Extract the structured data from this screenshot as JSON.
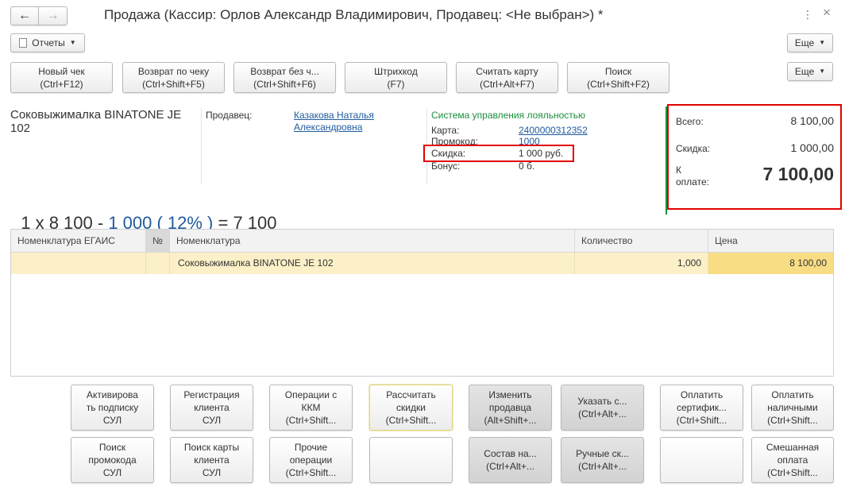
{
  "window": {
    "title": "Продажа (Кассир: Орлов Александр Владимирович, Продавец: <Не выбран>) *",
    "more_icon": "⋮",
    "close_icon": "×"
  },
  "toolbar": {
    "reports_label": "Отчеты",
    "more_label": "Еще"
  },
  "actions": [
    {
      "line1": "Новый чек",
      "line2": "(Ctrl+F12)"
    },
    {
      "line1": "Возврат по чеку",
      "line2": "(Ctrl+Shift+F5)"
    },
    {
      "line1": "Возврат без ч...",
      "line2": "(Ctrl+Shift+F6)"
    },
    {
      "line1": "Штрихкод",
      "line2": "(F7)"
    },
    {
      "line1": "Считать карту",
      "line2": "(Ctrl+Alt+F7)"
    },
    {
      "line1": "Поиск",
      "line2": "(Ctrl+Shift+F2)"
    }
  ],
  "actions_more_label": "Еще",
  "product": {
    "name": "Соковыжималка  BINATONE JE 102"
  },
  "seller": {
    "label": "Продавец:",
    "name": "Казакова Наталья Александровна"
  },
  "loyalty": {
    "title": "Система управления лояльностью",
    "card_label": "Карта:",
    "card_value": "2400000312352",
    "promo_label": "Промокод:",
    "promo_value": "1000",
    "discount_label": "Скидка:",
    "discount_value": "1 000 руб.",
    "bonus_label": "Бонус:",
    "bonus_value": "0 б."
  },
  "totals": {
    "total_label": "Всего:",
    "total_value": "8 100,00",
    "discount_label": "Скидка:",
    "discount_value": "1 000,00",
    "pay_label_1": "К",
    "pay_label_2": "оплате:",
    "pay_value": "7 100,00"
  },
  "formula": {
    "prefix": "1 х 8 100 - ",
    "discount_link": "1 000 ( 12% )",
    "suffix": " = 7 100"
  },
  "table": {
    "columns": [
      "Номенклатура ЕГАИС",
      "№",
      "Номенклатура",
      "Количество",
      "Цена"
    ],
    "rows": [
      {
        "egais": "",
        "num": "",
        "name": "Соковыжималка  BINATONE JE 102",
        "qty": "1,000",
        "price": "8 100,00"
      }
    ]
  },
  "bottom_buttons_row1": [
    {
      "lines": [
        "Активирова",
        "ть подписку",
        "СУЛ"
      ]
    },
    {
      "lines": [
        "Регистрация",
        "клиента",
        "СУЛ"
      ]
    },
    {
      "lines": [
        "Операции с",
        "ККМ",
        "(Ctrl+Shift..."
      ]
    },
    {
      "lines": [
        "Рассчитать",
        "скидки",
        "(Ctrl+Shift..."
      ]
    },
    {
      "lines": [
        "Изменить",
        "продавца",
        "(Alt+Shift+..."
      ]
    },
    {
      "lines": [
        "Указать с...",
        "(Ctrl+Alt+..."
      ]
    },
    {
      "lines": [
        "Оплатить",
        "сертифик...",
        "(Ctrl+Shift..."
      ]
    },
    {
      "lines": [
        "Оплатить",
        "наличными",
        "(Ctrl+Shift..."
      ]
    }
  ],
  "bottom_buttons_row2": [
    {
      "lines": [
        "Поиск",
        "промокода",
        "СУЛ"
      ]
    },
    {
      "lines": [
        "Поиск карты",
        "клиента",
        "СУЛ"
      ]
    },
    {
      "lines": [
        "Прочие",
        "операции",
        "(Ctrl+Shift..."
      ]
    },
    {
      "lines": []
    },
    {
      "lines": [
        "Состав на...",
        "(Ctrl+Alt+..."
      ]
    },
    {
      "lines": [
        "Ручные ск...",
        "(Ctrl+Alt+..."
      ]
    },
    {
      "lines": []
    },
    {
      "lines": [
        "Смешанная",
        "оплата",
        "(Ctrl+Shift..."
      ]
    }
  ]
}
